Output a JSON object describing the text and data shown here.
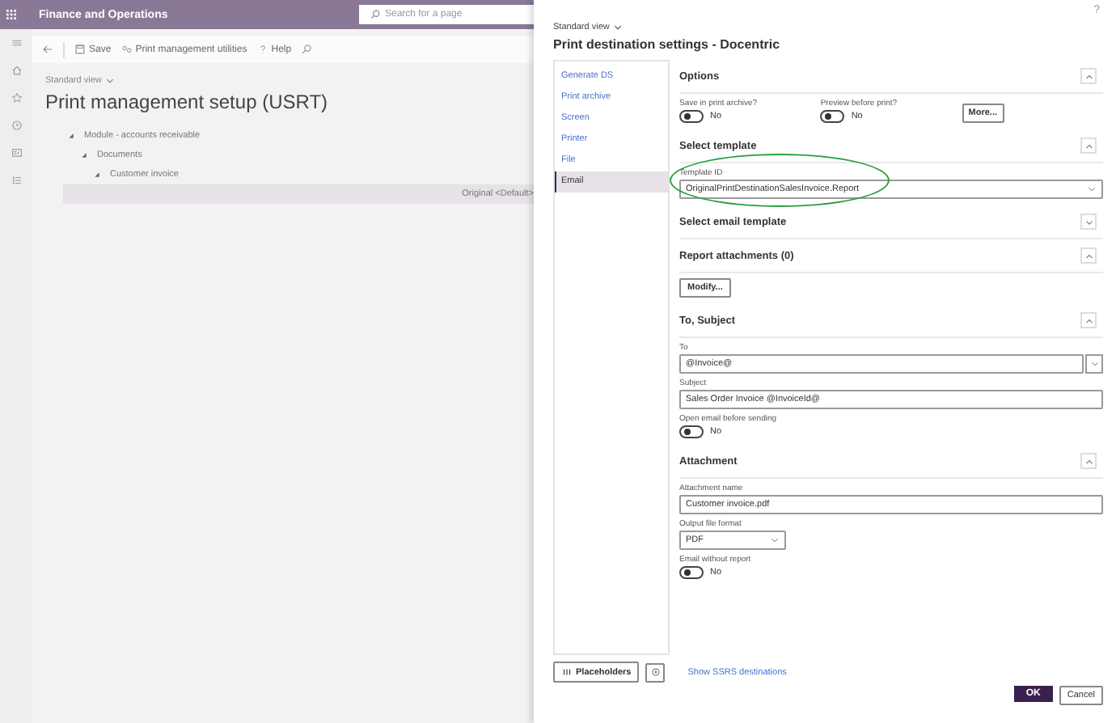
{
  "top_bar": {
    "app_title": "Finance and Operations",
    "search": {
      "placeholder": "Search for a page"
    }
  },
  "toolbar": [
    {
      "kind": "save",
      "label": "Save"
    },
    {
      "kind": "utilities",
      "label": "Print management utilities"
    },
    {
      "kind": "help",
      "label": "Help"
    }
  ],
  "page": {
    "view": "Standard view",
    "title": "Print management setup (USRT)",
    "tree": [
      {
        "label": "Module - accounts receivable",
        "expanded": true,
        "selected": false,
        "children": [
          {
            "label": "Documents",
            "expanded": true,
            "selected": false,
            "children": [
              {
                "label": "Customer invoice",
                "expanded": true,
                "selected": false,
                "children": [
                  {
                    "label": "Original <Default>",
                    "expanded": false,
                    "selected": true
                  }
                ]
              }
            ]
          }
        ]
      }
    ]
  },
  "dialog": {
    "help": "?",
    "view": "Standard view",
    "title": "Print destination settings - Docentric",
    "nav": [
      {
        "label": "Generate DS",
        "selected": false
      },
      {
        "label": "Print archive",
        "selected": false
      },
      {
        "label": "Screen",
        "selected": false
      },
      {
        "label": "Printer",
        "selected": false
      },
      {
        "label": "File",
        "selected": false
      },
      {
        "label": "Email",
        "selected": true
      }
    ],
    "sections": [
      {
        "title": "Options",
        "expanded": true,
        "kind": "row",
        "fields": [
          {
            "kind": "toggle",
            "label": "Save in print archive?",
            "on": false,
            "value": "No"
          },
          {
            "kind": "toggle",
            "label": "Preview before print?",
            "on": false,
            "value": "No"
          },
          {
            "kind": "button",
            "label": "More..."
          }
        ]
      },
      {
        "title": "Select template",
        "expanded": true,
        "kind": "column",
        "fields": [
          {
            "kind": "select",
            "label": "Template ID",
            "value": "OriginalPrintDestinationSalesInvoice.Report",
            "highlighted": true
          }
        ]
      },
      {
        "title": "Select email template",
        "expanded": false
      },
      {
        "title": "Report attachments (0)",
        "expanded": true,
        "kind": "column",
        "fields": [
          {
            "kind": "button",
            "label": "Modify..."
          }
        ]
      },
      {
        "title": "To, Subject",
        "expanded": true,
        "kind": "column",
        "fields": [
          {
            "kind": "combo",
            "label": "To",
            "value": "@Invoice@"
          },
          {
            "kind": "text",
            "label": "Subject",
            "value": "Sales Order Invoice @InvoiceId@"
          },
          {
            "kind": "toggle",
            "label": "Open email before sending",
            "on": false,
            "value": "No"
          }
        ]
      },
      {
        "title": "Attachment",
        "expanded": true,
        "kind": "column",
        "fields": [
          {
            "kind": "text",
            "label": "Attachment name",
            "value": "Customer invoice.pdf"
          },
          {
            "kind": "short_select",
            "label": "Output file format",
            "value": "PDF"
          },
          {
            "kind": "toggle",
            "label": "Email without report",
            "on": false,
            "value": "No"
          }
        ]
      }
    ],
    "footer": {
      "placeholders": "Placeholders",
      "link": "Show SSRS destinations",
      "ok": "OK",
      "cancel": "Cancel"
    }
  }
}
